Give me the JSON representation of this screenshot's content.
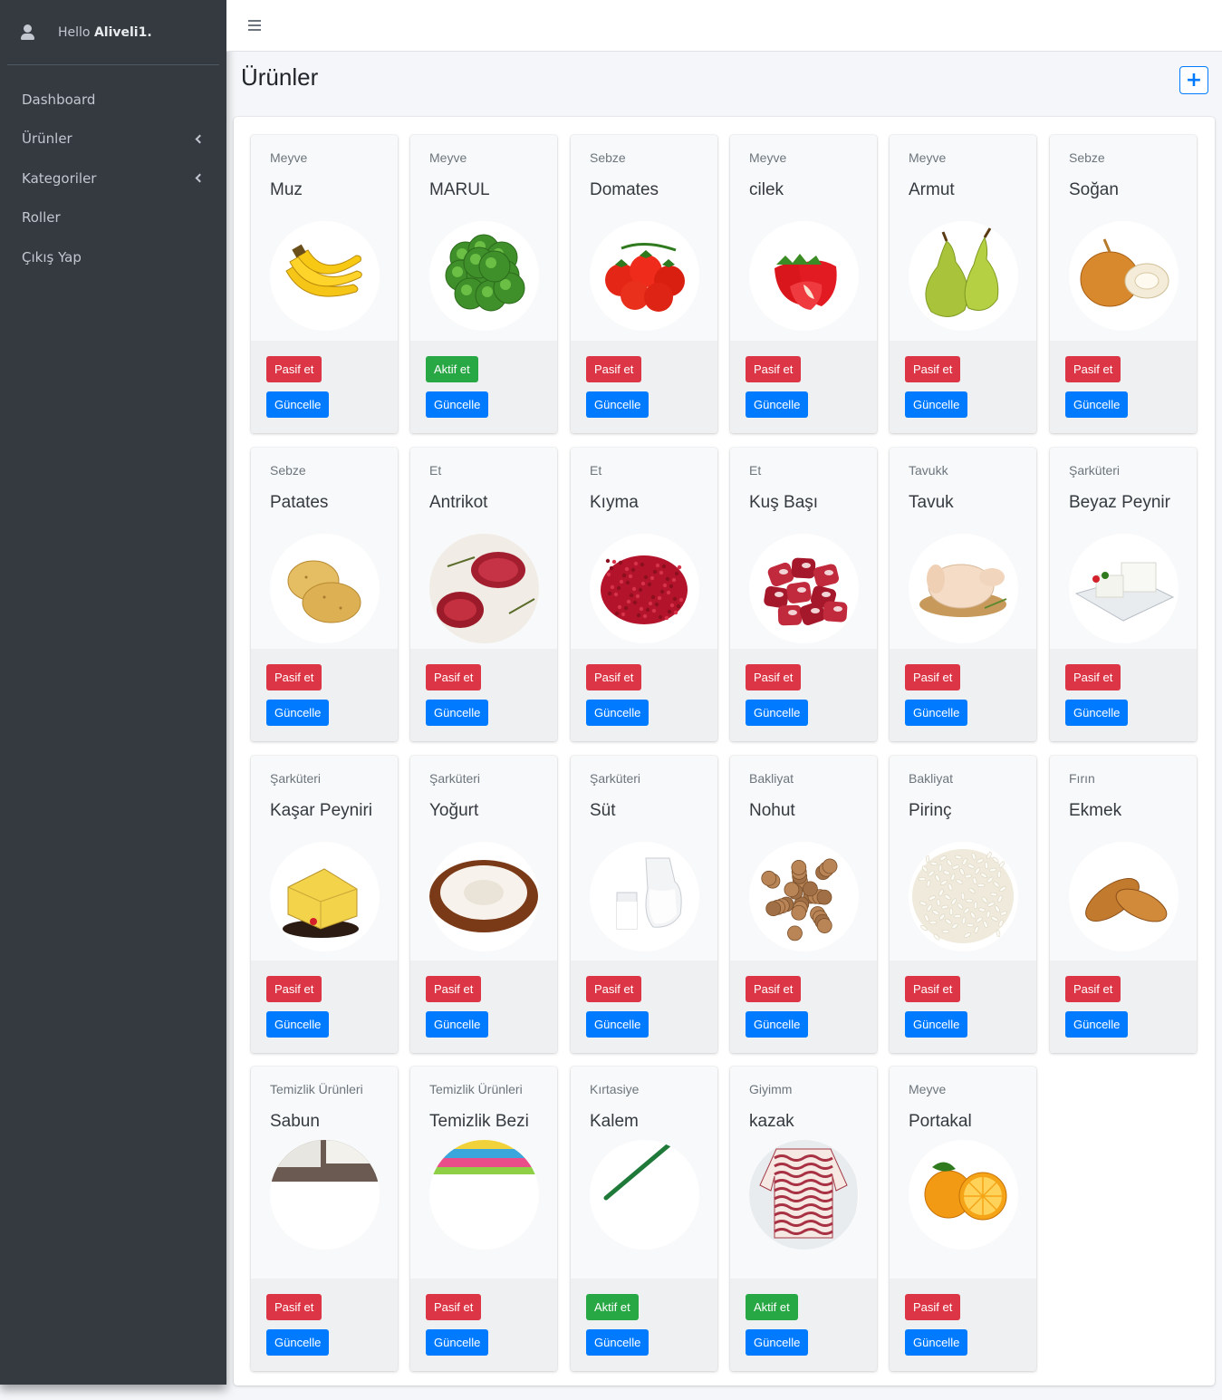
{
  "user": {
    "greeting": "Hello",
    "name": "Aliveli1."
  },
  "nav": [
    {
      "label": "Dashboard",
      "has_children": false
    },
    {
      "label": "Ürünler",
      "has_children": true
    },
    {
      "label": "Kategoriler",
      "has_children": true
    },
    {
      "label": "Roller",
      "has_children": false
    },
    {
      "label": "Çıkış Yap",
      "has_children": false
    }
  ],
  "page": {
    "title": "Ürünler",
    "add_label": "+"
  },
  "labels": {
    "passive": "Pasif et",
    "active": "Aktif et",
    "update": "Güncelle"
  },
  "products": [
    {
      "category": "Meyve",
      "name": "Muz",
      "status": "active",
      "image": "banana"
    },
    {
      "category": "Meyve",
      "name": "MARUL",
      "status": "passive",
      "image": "lettuce"
    },
    {
      "category": "Sebze",
      "name": "Domates",
      "status": "active",
      "image": "tomato"
    },
    {
      "category": "Meyve",
      "name": "cilek",
      "status": "active",
      "image": "strawberry"
    },
    {
      "category": "Meyve",
      "name": "Armut",
      "status": "active",
      "image": "pear"
    },
    {
      "category": "Sebze",
      "name": "Soğan",
      "status": "active",
      "image": "onion"
    },
    {
      "category": "Sebze",
      "name": "Patates",
      "status": "active",
      "image": "potato"
    },
    {
      "category": "Et",
      "name": "Antrikot",
      "status": "active",
      "image": "steak"
    },
    {
      "category": "Et",
      "name": "Kıyma",
      "status": "active",
      "image": "mince"
    },
    {
      "category": "Et",
      "name": "Kuş Başı",
      "status": "active",
      "image": "cubed-meat"
    },
    {
      "category": "Tavukk",
      "name": "Tavuk",
      "status": "active",
      "image": "chicken"
    },
    {
      "category": "Şarküteri",
      "name": "Beyaz Peynir",
      "status": "active",
      "image": "white-cheese"
    },
    {
      "category": "Şarküteri",
      "name": "Kaşar Peyniri",
      "status": "active",
      "image": "kashar-cheese"
    },
    {
      "category": "Şarküteri",
      "name": "Yoğurt",
      "status": "active",
      "image": "yogurt"
    },
    {
      "category": "Şarküteri",
      "name": "Süt",
      "status": "active",
      "image": "milk"
    },
    {
      "category": "Bakliyat",
      "name": "Nohut",
      "status": "active",
      "image": "chickpea"
    },
    {
      "category": "Bakliyat",
      "name": "Pirinç",
      "status": "active",
      "image": "rice"
    },
    {
      "category": "Fırın",
      "name": "Ekmek",
      "status": "active",
      "image": "bread"
    },
    {
      "category": "Temizlik Ürünleri",
      "name": "Sabun",
      "status": "active",
      "image": "soap"
    },
    {
      "category": "Temizlik Ürünleri",
      "name": "Temizlik Bezi",
      "status": "active",
      "image": "cloth"
    },
    {
      "category": "Kırtasiye",
      "name": "Kalem",
      "status": "passive",
      "image": "pen"
    },
    {
      "category": "Giyimm",
      "name": "kazak",
      "status": "passive",
      "image": "sweater"
    },
    {
      "category": "Meyve",
      "name": "Portakal",
      "status": "active",
      "image": "orange"
    }
  ]
}
